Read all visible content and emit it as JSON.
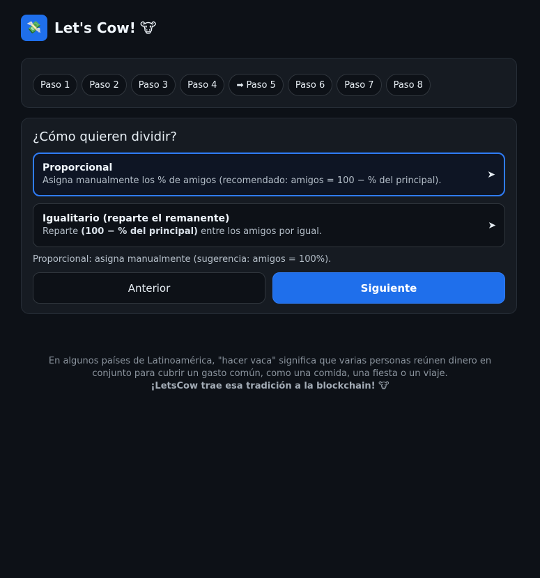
{
  "header": {
    "logo_icon": "💸",
    "title": "Let's Cow!",
    "title_emoji": "🐮"
  },
  "steps": [
    {
      "label": "Paso 1",
      "active": false
    },
    {
      "label": "Paso 2",
      "active": false
    },
    {
      "label": "Paso 3",
      "active": false
    },
    {
      "label": "Paso 4",
      "active": false
    },
    {
      "label": "Paso 5",
      "active": true,
      "prefix": "➡"
    },
    {
      "label": "Paso 6",
      "active": false
    },
    {
      "label": "Paso 7",
      "active": false
    },
    {
      "label": "Paso 8",
      "active": false
    }
  ],
  "split": {
    "question": "¿Cómo quieren dividir?",
    "options": [
      {
        "title": "Proporcional",
        "description": "Asigna manualmente los % de amigos (recomendado: amigos = 100 − % del principal).",
        "selected": true,
        "arrow": "➤"
      },
      {
        "title": "Igualitario (reparte el remanente)",
        "desc_before": "Reparte ",
        "desc_bold": "(100 − % del principal)",
        "desc_after": " entre los amigos por igual.",
        "selected": false,
        "arrow": "➤"
      }
    ],
    "hint": "Proporcional: asigna manualmente (sugerencia: amigos = 100%)."
  },
  "nav": {
    "prev_label": "Anterior",
    "next_label": "Siguiente"
  },
  "footer": {
    "line1": "En algunos países de Latinoamérica, \"hacer vaca\" significa que varias personas reúnen dinero en conjunto para cubrir un gasto común, como una comida, una fiesta o un viaje.",
    "line2": "¡LetsCow trae esa tradición a la blockchain! 🐮"
  },
  "colors": {
    "accent": "#1f6feb",
    "background": "#0d1117",
    "card": "#161b22"
  }
}
